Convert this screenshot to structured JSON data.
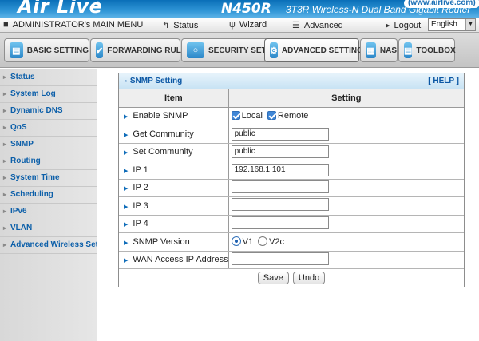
{
  "header": {
    "logo": "Air Live",
    "logo_tm": "®",
    "url": "(www.airlive.com)",
    "model": "N450R",
    "model_desc": "3T3R Wireless-N Dual Band Gigabit Router"
  },
  "topnav": {
    "admin_menu": "ADMINISTRATOR's MAIN MENU",
    "status": "Status",
    "wizard": "Wizard",
    "advanced": "Advanced",
    "logout": "Logout",
    "language": "English"
  },
  "tabs": [
    {
      "label": "BASIC SETTING"
    },
    {
      "label": "FORWARDING RULES"
    },
    {
      "label": "SECURITY SETTING"
    },
    {
      "label": "ADVANCED SETTING"
    },
    {
      "label": "NAS"
    },
    {
      "label": "TOOLBOX"
    }
  ],
  "sidebar": {
    "items": [
      {
        "label": "Status"
      },
      {
        "label": "System Log"
      },
      {
        "label": "Dynamic DNS"
      },
      {
        "label": "QoS"
      },
      {
        "label": "SNMP"
      },
      {
        "label": "Routing"
      },
      {
        "label": "System Time"
      },
      {
        "label": "Scheduling"
      },
      {
        "label": "IPv6"
      },
      {
        "label": "VLAN"
      },
      {
        "label": "Advanced Wireless Settings"
      }
    ]
  },
  "panel": {
    "title": "SNMP Setting",
    "help": "[ HELP ]",
    "col_item": "Item",
    "col_setting": "Setting",
    "enable_label": "Enable SNMP",
    "enable_local": "Local",
    "enable_remote": "Remote",
    "get_label": "Get Community",
    "get_value": "public",
    "set_label": "Set Community",
    "set_value": "public",
    "ip1_label": "IP 1",
    "ip1_value": "192.168.1.101",
    "ip2_label": "IP 2",
    "ip2_value": "",
    "ip3_label": "IP 3",
    "ip3_value": "",
    "ip4_label": "IP 4",
    "ip4_value": "",
    "version_label": "SNMP Version",
    "version_v1": "V1",
    "version_v2c": "V2c",
    "wan_label": "WAN Access IP Address",
    "wan_value": "",
    "save": "Save",
    "undo": "Undo"
  }
}
